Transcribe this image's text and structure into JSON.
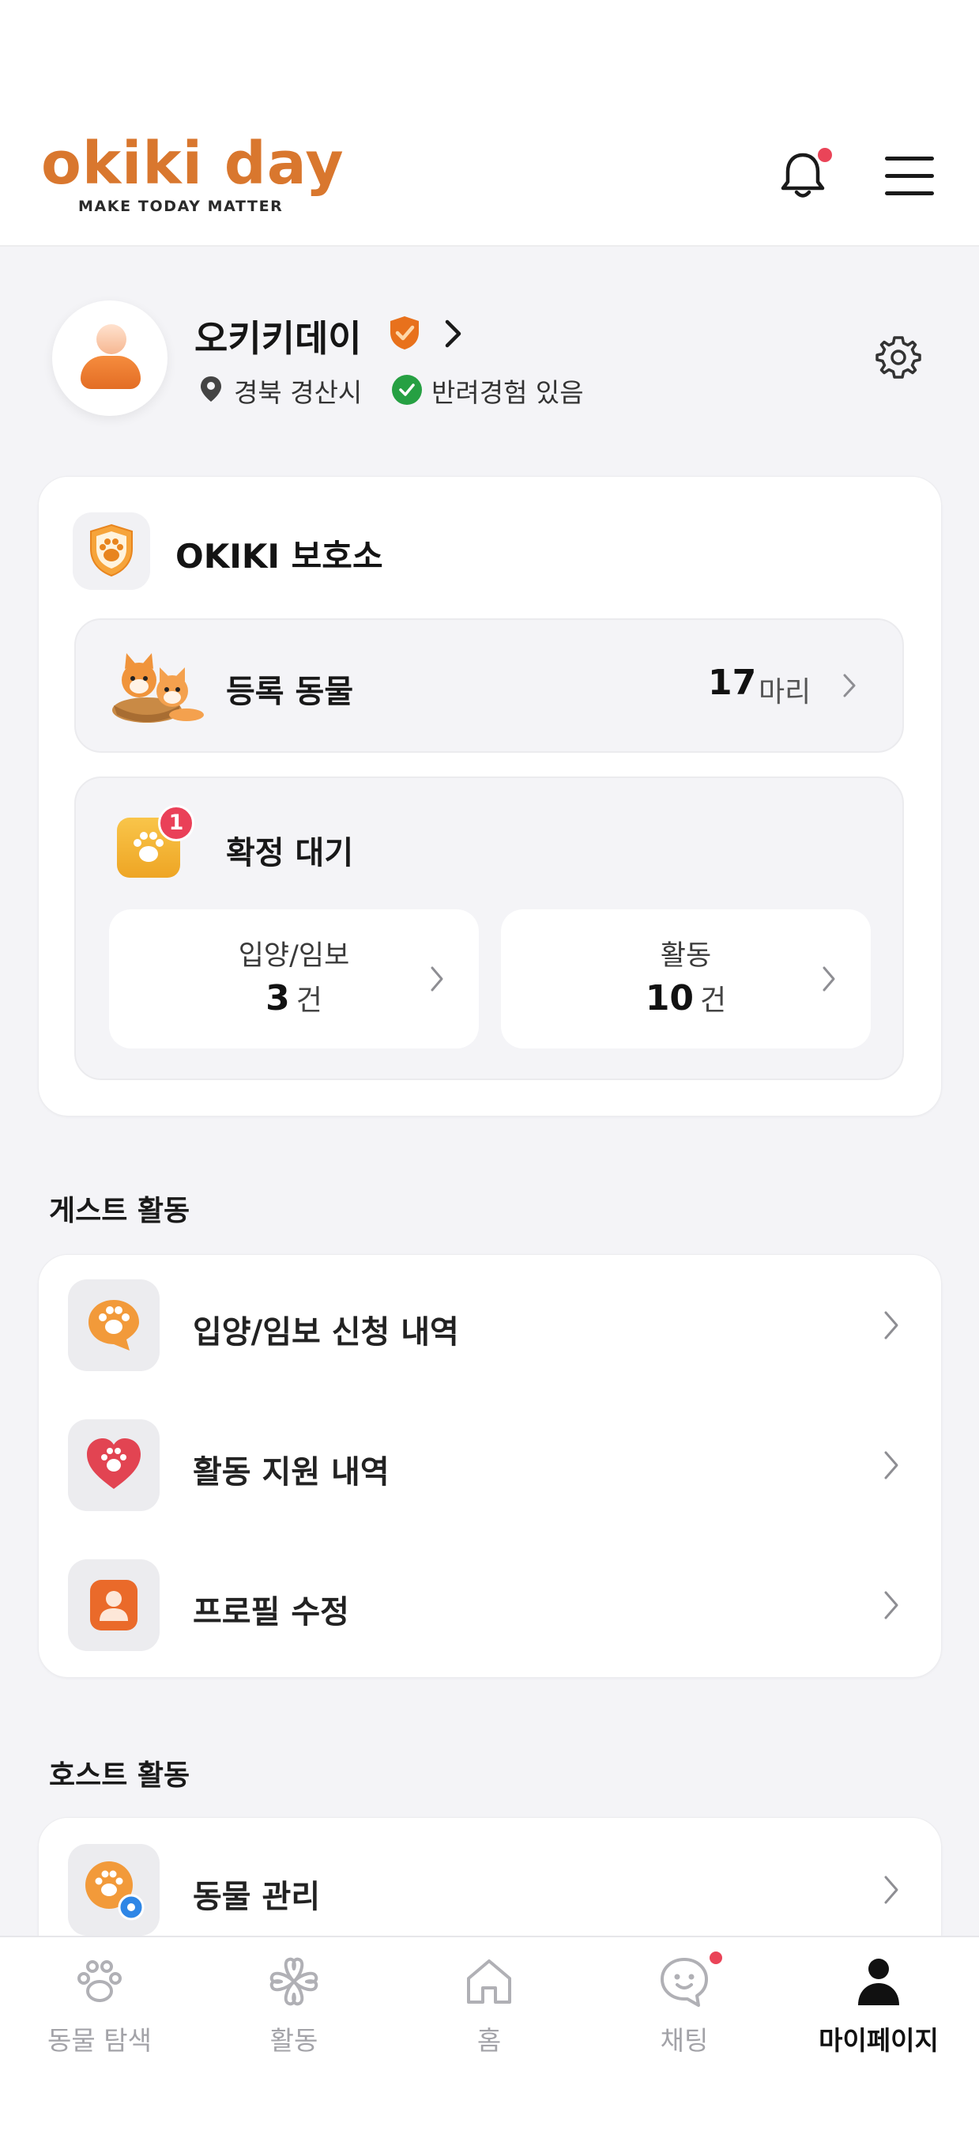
{
  "header": {
    "logo_text": "okiki day",
    "logo_tagline": "MAKE TODAY MATTER",
    "notification_badge": true
  },
  "profile": {
    "name": "오키키데이",
    "location": "경북 경산시",
    "experience": "반려경험 있음"
  },
  "shelter": {
    "name": "OKIKI 보호소",
    "registered_label": "등록 동물",
    "registered_count": "17",
    "registered_unit": "마리",
    "pending_label": "확정 대기",
    "pending_badge": "1",
    "adoption": {
      "label": "입양/임보",
      "count": "3",
      "unit": "건"
    },
    "activity": {
      "label": "활동",
      "count": "10",
      "unit": "건"
    }
  },
  "guest_section": {
    "title": "게스트 활동",
    "items": [
      {
        "label": "입양/임보 신청 내역",
        "icon": "paw-chat-icon"
      },
      {
        "label": "활동 지원 내역",
        "icon": "heart-paw-icon"
      },
      {
        "label": "프로필 수정",
        "icon": "profile-card-icon"
      }
    ]
  },
  "host_section": {
    "title": "호스트 활동",
    "items": [
      {
        "label": "동물 관리",
        "icon": "paw-gear-icon"
      }
    ]
  },
  "nav": {
    "items": [
      {
        "label": "동물 탐색",
        "icon": "paw-icon",
        "active": false
      },
      {
        "label": "활동",
        "icon": "clover-icon",
        "active": false
      },
      {
        "label": "홈",
        "icon": "home-icon",
        "active": false
      },
      {
        "label": "채팅",
        "icon": "chat-icon",
        "active": false
      },
      {
        "label": "마이페이지",
        "icon": "person-icon",
        "active": true
      }
    ]
  },
  "colors": {
    "brand": "#d9772e",
    "alert": "#ea4458",
    "verified": "#26a043"
  }
}
